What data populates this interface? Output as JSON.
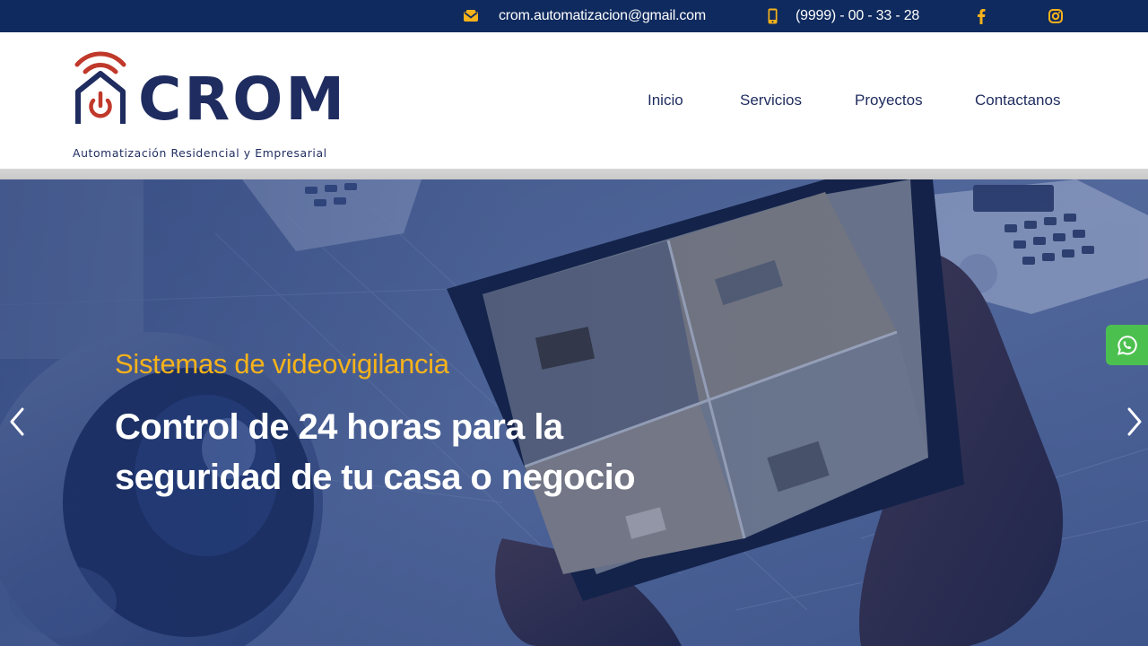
{
  "topbar": {
    "email": "crom.automatizacion@gmail.com",
    "phone": "(9999) - 00 - 33 - 28",
    "email_icon": "envelope-icon",
    "phone_icon": "mobile-phone-icon",
    "social": [
      {
        "icon": "facebook-icon"
      },
      {
        "icon": "instagram-icon"
      }
    ]
  },
  "header": {
    "logo": {
      "word": "CROM",
      "tagline": "Automatización Residencial y Empresarial",
      "icon": "smart-home-wifi-power-icon"
    },
    "nav": [
      {
        "label": "Inicio"
      },
      {
        "label": "Servicios"
      },
      {
        "label": "Proyectos"
      },
      {
        "label": "Contactanos"
      }
    ]
  },
  "hero": {
    "subtitle": "Sistemas de videovigilancia",
    "title": "Control de 24 horas para la seguridad de tu casa o negocio",
    "prev_icon": "chevron-left-icon",
    "next_icon": "chevron-right-icon",
    "whatsapp_icon": "whatsapp-icon"
  },
  "colors": {
    "topbar_bg": "#0f2a5e",
    "brand_navy": "#1f2c5f",
    "accent_yellow": "#f5b21b",
    "logo_red": "#c0392b",
    "whatsapp_green": "#4cc04f"
  }
}
